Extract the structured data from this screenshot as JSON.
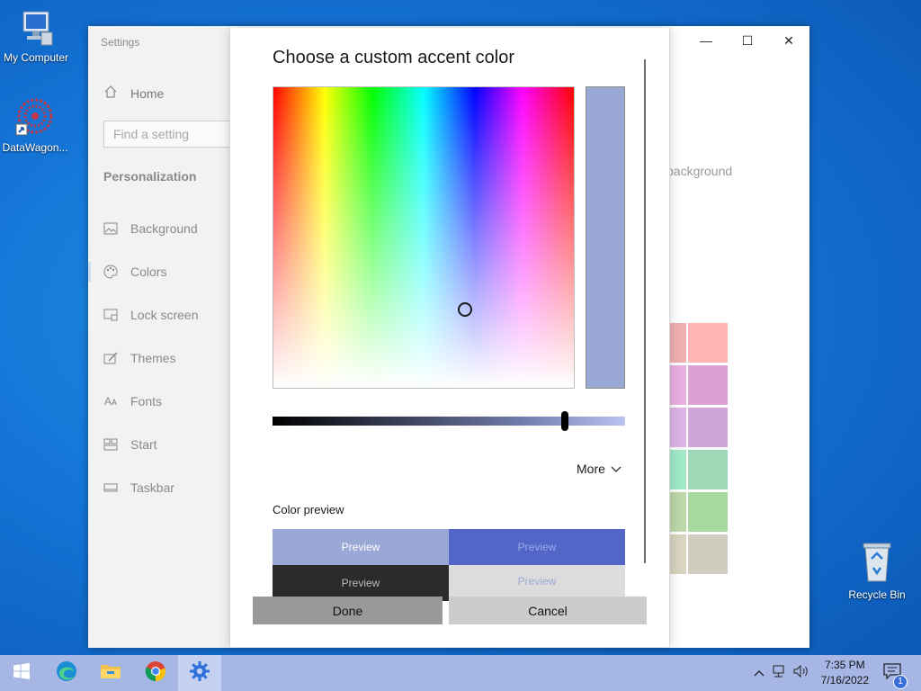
{
  "desktop": {
    "icons": [
      {
        "label": "My Computer"
      },
      {
        "label": "DataWagon..."
      },
      {
        "label": "Recycle Bin"
      }
    ]
  },
  "settings": {
    "title": "Settings",
    "home": "Home",
    "search_placeholder": "Find a setting",
    "section": "Personalization",
    "nav": [
      {
        "label": "Background",
        "icon": "picture-icon"
      },
      {
        "label": "Colors",
        "icon": "palette-icon"
      },
      {
        "label": "Lock screen",
        "icon": "lock-screen-icon"
      },
      {
        "label": "Themes",
        "icon": "themes-icon"
      },
      {
        "label": "Fonts",
        "icon": "fonts-icon"
      },
      {
        "label": "Start",
        "icon": "start-icon"
      },
      {
        "label": "Taskbar",
        "icon": "taskbar-icon"
      }
    ],
    "right_text": "background",
    "swatch_colors": [
      "#eeb0b0",
      "#ffb3b3",
      "#e8b0e0",
      "#dba0d4",
      "#ddb3e8",
      "#cfa6d8",
      "#a0e8c8",
      "#9fd8b6",
      "#bcd8a8",
      "#a6d8a0",
      "#d8d4c0",
      "#cfccc0"
    ]
  },
  "dialog": {
    "title": "Choose a custom accent color",
    "more_label": "More",
    "preview_label": "Color preview",
    "preview_text": "Preview",
    "done_label": "Done",
    "cancel_label": "Cancel",
    "selected_color": "#9aa8d6",
    "value_fraction": 0.83
  },
  "taskbar": {
    "time": "7:35 PM",
    "date": "7/16/2022",
    "notification_count": "1"
  }
}
